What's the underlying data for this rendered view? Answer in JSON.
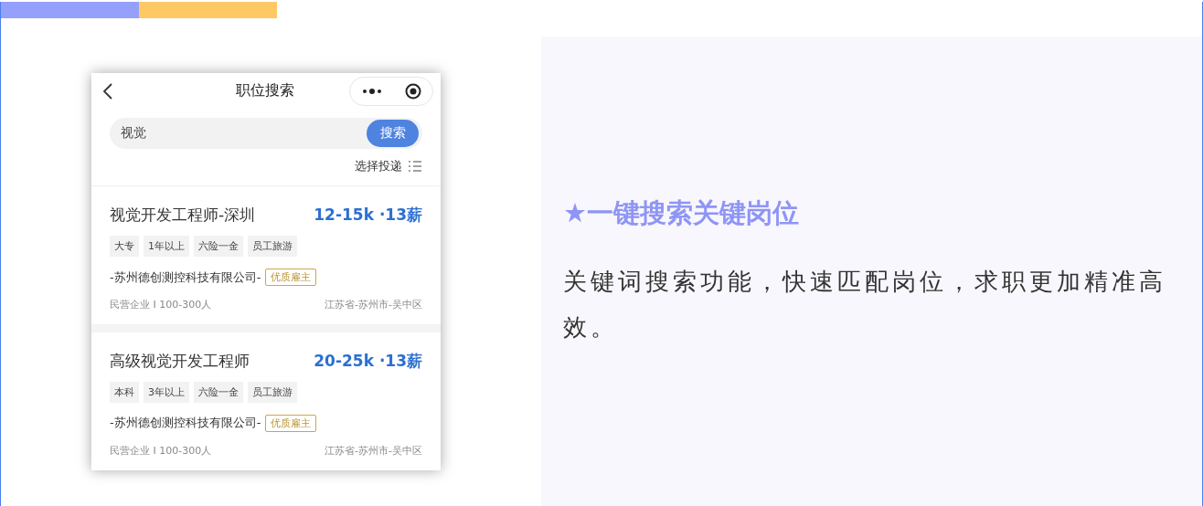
{
  "phone": {
    "title": "职位搜索",
    "search": {
      "value": "视觉",
      "button": "搜索"
    },
    "select_delivery": "选择投递",
    "jobs": [
      {
        "title": "视觉开发工程师-深圳",
        "salary": "12-15k ·13薪",
        "tags": [
          "大专",
          "1年以上",
          "六险一金",
          "员工旅游"
        ],
        "company": "-苏州德创测控科技有限公司-",
        "badge": "优质雇主",
        "company_info": "民营企业 I 100-300人",
        "location": "江苏省-苏州市-吴中区"
      },
      {
        "title": "高级视觉开发工程师",
        "salary": "20-25k ·13薪",
        "tags": [
          "本科",
          "3年以上",
          "六险一金",
          "员工旅游"
        ],
        "company": "-苏州德创测控科技有限公司-",
        "badge": "优质雇主",
        "company_info": "民营企业 I 100-300人",
        "location": "江苏省-苏州市-吴中区"
      }
    ]
  },
  "feature": {
    "heading": "★一键搜索关键岗位",
    "description": "关键词搜索功能，快速匹配岗位，求职更加精准高效。"
  }
}
